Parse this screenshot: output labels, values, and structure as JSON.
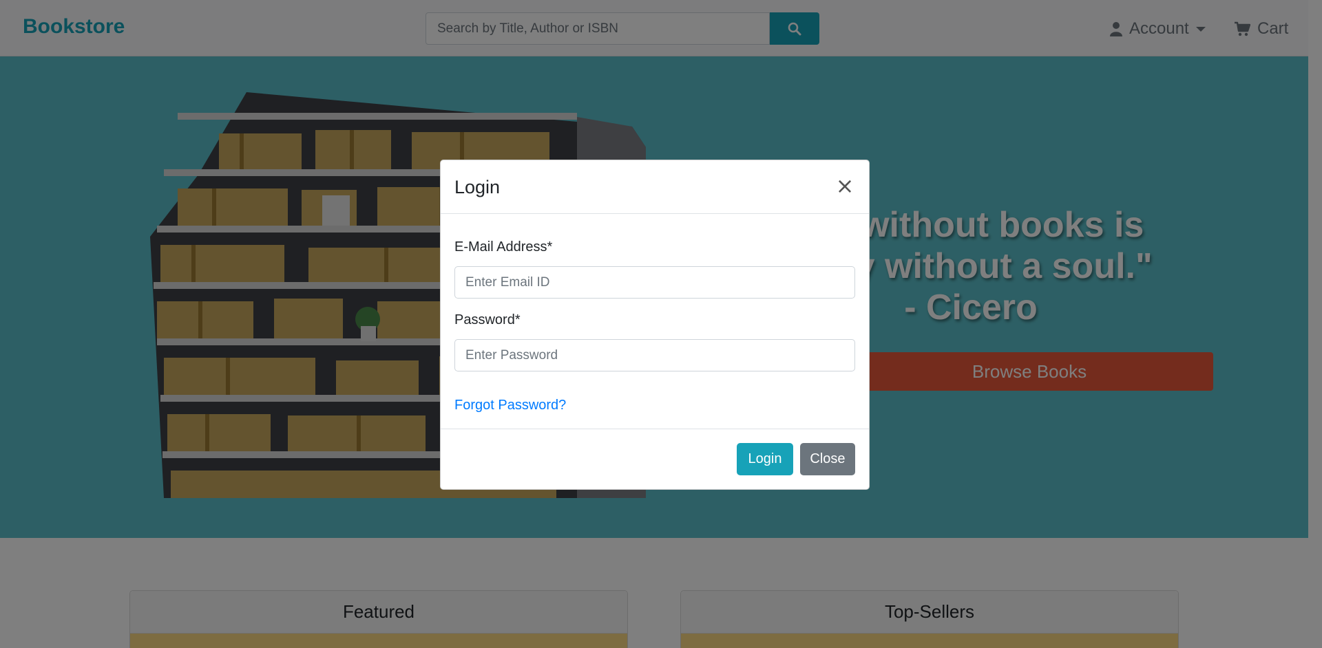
{
  "navbar": {
    "brand": "Bookstore",
    "search_placeholder": "Search by Title, Author or ISBN",
    "search_icon": "search-icon",
    "account_label": "Account",
    "account_icon": "user-icon",
    "cart_label": "Cart",
    "cart_icon": "cart-icon"
  },
  "hero": {
    "quote_line1": "om without books is",
    "quote_line2": "body without a soul.\"",
    "quote_line3": "- Cicero",
    "browse_label": "Browse Books"
  },
  "sections": {
    "featured_title": "Featured",
    "top_sellers_title": "Top-Sellers"
  },
  "modal": {
    "title": "Login",
    "close_symbol": "×",
    "email_label": "E-Mail Address*",
    "email_placeholder": "Enter Email ID",
    "password_label": "Password*",
    "password_placeholder": "Enter Password",
    "forgot_label": "Forgot Password?",
    "login_label": "Login",
    "close_label": "Close"
  },
  "colors": {
    "accent": "#17a2b8",
    "hero_bg": "#5bbfca",
    "browse_btn": "#e8593a",
    "secondary": "#6c757d",
    "link": "#007bff"
  }
}
